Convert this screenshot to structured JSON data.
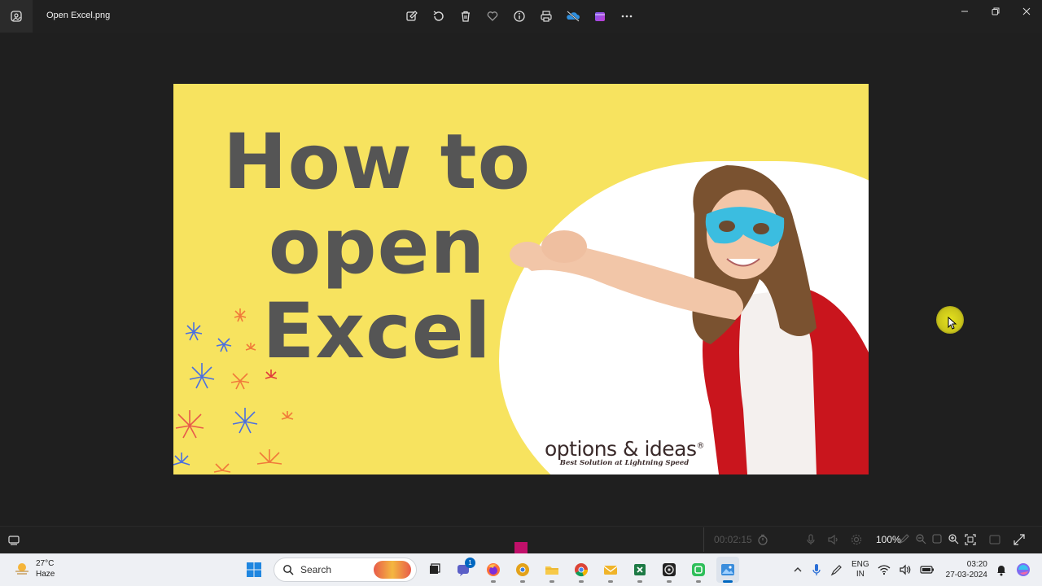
{
  "titlebar": {
    "file_name": "Open Excel.png",
    "app_icon": "photos-icon",
    "toolbar_icons": [
      "edit-image-icon",
      "rotate-icon",
      "delete-icon",
      "favorite-icon",
      "info-icon",
      "print-icon",
      "onedrive-icon",
      "clipchamp-icon",
      "more-icon"
    ],
    "window_controls": [
      "minimize-icon",
      "restore-icon",
      "close-icon"
    ]
  },
  "image": {
    "headline": [
      "How to",
      "open",
      "Excel"
    ],
    "logo_text": "options & ideas",
    "logo_mark": "®",
    "logo_tagline": "Best Solution at Lightning Speed",
    "colors": {
      "background": "#f7e35f",
      "headline": "#555555",
      "cape": "#c9151d",
      "mask": "#3bbde0"
    }
  },
  "statusbar": {
    "timer": "00:02:15",
    "zoom": "100%"
  },
  "taskbar": {
    "weather_temp": "27°C",
    "weather_desc": "Haze",
    "search_placeholder": "Search",
    "chat_badge": "1",
    "lang_line1": "ENG",
    "lang_line2": "IN",
    "time": "03:20",
    "date": "27-03-2024",
    "apps": [
      "task-view-icon",
      "chat-icon",
      "firefox-icon",
      "chrome-canary-icon",
      "file-explorer-icon",
      "chrome-icon",
      "mail-icon",
      "excel-icon",
      "obs-icon",
      "green-app-icon",
      "photos-icon"
    ]
  }
}
